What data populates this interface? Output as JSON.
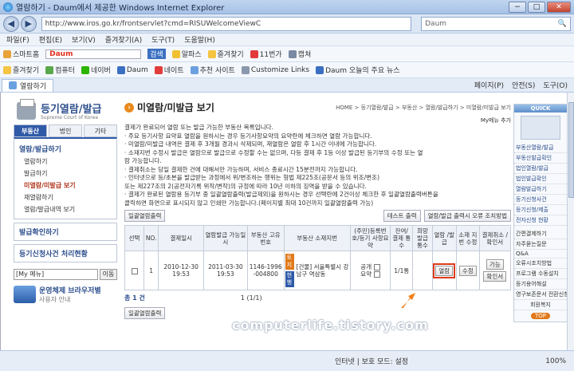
{
  "window": {
    "title": "열람하기 - Daum에서 제공한 Windows Internet Explorer",
    "buttons": [
      "−",
      "□",
      "✕"
    ]
  },
  "address": {
    "url": "http://www.iros.go.kr/frontservlet?cmd=RISUWelcomeViewC",
    "search_placeholder": "Daum"
  },
  "menu": [
    "파일(F)",
    "편집(E)",
    "보기(V)",
    "즐겨찾기(A)",
    "도구(T)",
    "도움말(H)"
  ],
  "linksbar": [
    "스마트홈",
    "Daum",
    "검색",
    "알파스",
    "즐겨찾기",
    "11번가",
    "캡쳐",
    "Customize Links"
  ],
  "favbar": [
    "즐겨찾기",
    "컴퓨터",
    "네이버",
    "Daum",
    "네이트",
    "추천 사이트",
    "Customize Links",
    "Daum 오늘의 주요 뉴스"
  ],
  "tabbar": {
    "tab": "열람하기",
    "tools": [
      "페이지(P)",
      "안전(S)",
      "도구(O)"
    ]
  },
  "logo": {
    "title": "등기열람/발급",
    "subtitle": "Supreme Court of Korea"
  },
  "sidebar": {
    "tabs": [
      "부동산",
      "법인",
      "기타"
    ],
    "section": "열람/발급하기",
    "items": [
      "열람하기",
      "발급하기",
      "미열람/미발급 보기",
      "재열람하기",
      "열람/발급내역 보기"
    ],
    "block1": "발급확인하기",
    "block2": "등기신청사건 처리현황",
    "mymenu": "[My 메뉴]",
    "go": "이동",
    "os_title": "운영체제 브라우저별",
    "os_sub": "사용자 안내"
  },
  "main": {
    "title": "미열람/미발급 보기",
    "breadcrumb": "HOME > 등기열람/발급 > 부동산 > 열람/발급하기 > 미열람/미발급 보기",
    "mydoc": "My메뉴 추가",
    "desc": [
      "결제가 완료되어 열람 또는 발급 가능한 부동산 목록입니다.",
      "· 주요 등기사항 요약표 열람을 원하시는 경우 등기사항요약의 요약란에 체크하면 열람 가능합니다.",
      "· 미열람/미발급 내역은 결제 후 3개월 경과시 삭제되며, 재열람은 열람 후 1시간 이내에 가능합니다.",
      "· 소재지번 수정시 발급은 열람으로 발급으로 수정할 수는 없으며, 다등 결제 후 1등 이상 발급된 등기부의 수정 또는 열",
      "  람 가능합니다.",
      "· 결제취소는 당일 결제한 건에 대해서만 가능하며, 서비스 종료시간 15분전까지 가능합니다.",
      "· 인터넷으로 등/초본을 발급받는 과정에서 위/변조하는 행위는 형법 제225조(공문서 등의 위조/변조)",
      "  또는 제227조의 2(공전자기록 위작/변작)의 규정에 따라 10년 이하의 징역을 받을 수 있습니다.",
      "· 결제가 완료된 열람용 등기부 중 일괄열람출력(발급제외)을 원하시는 경우 선택란에 2건이상 체크한 후 일괄열람출력버튼을",
      "  클릭하면 화면으로 표시되지 않고 인쇄만 가능합니다.(페이지별 최대 10건까지 일괄열람출력 가능)"
    ],
    "btn_batch": "일괄열람출력",
    "btn_test": "테스트 출력",
    "btn_help": "열람/발급 출력시 오류 조치방법",
    "columns": [
      "선택",
      "NO.",
      "결제일시",
      "열람발급 가능일시",
      "부동산 고유번호",
      "부동산 소재지번",
      "(주민)등록번호/등기 사항요약",
      "잔여/ 결제 통수",
      "희망 발급 통수",
      "열람 /발급",
      "소재 지번 수정",
      "결제취소 /확인서"
    ],
    "row": {
      "no": "1",
      "paid": "2010-12-30 19:53",
      "avail": "2011-03-30 19:53",
      "uid": "1146-1996 -004800",
      "tag1": "토지",
      "tag2": "현행",
      "addr": "[건물] 서울특별시 강남구 역삼동",
      "pub": "공개",
      "summary": "요약",
      "remain": "1/1통",
      "view": "열람",
      "edit": "수정",
      "cancel1": "가능",
      "cancel2": "확인서"
    },
    "total": "총 1 건",
    "pager": "1    (1/1)"
  },
  "quick": {
    "header": "QUICK",
    "items": [
      "부동산열람/발급",
      "부동산발급확인",
      "법인열람/발급",
      "법인발급확인",
      "열람발급하기",
      "등기신청사건",
      "등기신청/제출",
      "전자신청 현황"
    ],
    "items2": [
      "간편결제하기",
      "자주묻는질문",
      "Q&A",
      "오류시조치방법",
      "프로그램 수동설치",
      "등기용어해설",
      "영구보존문서 전환신청"
    ],
    "last": "회원복지",
    "top": "TOP"
  },
  "watermark": "computerlife.tistory.com",
  "status": {
    "zone": "인터넷 | 보호 모드: 설정",
    "zoom": "100%"
  }
}
